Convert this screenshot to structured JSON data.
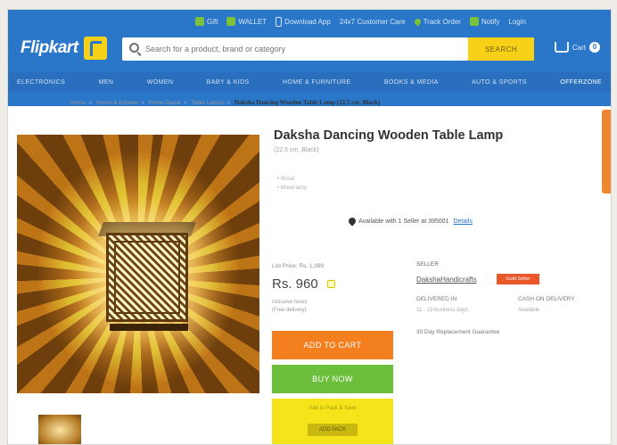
{
  "header": {
    "top_links": [
      {
        "icon": "gift-icon",
        "label": "Gift"
      },
      {
        "icon": "wallet-icon",
        "label": "WALLET"
      },
      {
        "icon": "phone-icon",
        "label": "Download App"
      },
      {
        "icon": "none",
        "label": "24x7 Customer Care"
      },
      {
        "icon": "location-pin-icon",
        "label": "Track Order"
      },
      {
        "icon": "bell-icon",
        "label": "Notify"
      },
      {
        "icon": "none",
        "label": "Login"
      }
    ],
    "logo_text": "Flipkart",
    "search_placeholder": "Search for a product, brand or category",
    "search_button": "SEARCH",
    "cart_label": "Cart",
    "cart_count": "0"
  },
  "nav": {
    "categories": [
      "ELECTRONICS",
      "MEN",
      "WOMEN",
      "BABY & KIDS",
      "HOME & FURNITURE",
      "BOOKS & MEDIA",
      "AUTO & SPORTS",
      "OFFERZONE"
    ]
  },
  "breadcrumb": {
    "items": [
      "Home",
      "Home & Kitchen",
      "Home Decor",
      "Table Lamps"
    ],
    "current": "Daksha Dancing Wooden Table Lamp (22.5 cm, Black)"
  },
  "product": {
    "title": "Daksha Dancing Wooden Table Lamp",
    "subtitle": "(22.5 cm, Black)",
    "bullets": [
      "Wood",
      "Mood lamp"
    ],
    "availability": "Available with 1 Seller at 395001",
    "availability_link": "Details",
    "list_price": "List Price: Rs. 1,099",
    "price": "Rs. 960",
    "price_note_1": "Inclusive taxes",
    "price_note_2": "(Free delivery)",
    "add_to_cart": "ADD TO CART",
    "buy_now": "BUY NOW",
    "pack_label": "Add to Pack & Save",
    "pack_button": "ADD PACK"
  },
  "seller": {
    "label": "SELLER",
    "name": "DakshaHandicrafts",
    "badge": "Gold Seller",
    "delivery_label": "DELIVERED IN",
    "delivery_value": "11 - 13 business days",
    "cash_label": "CASH ON DELIVERY",
    "cash_value": "Available",
    "shipping": "30 Day Replacement Guarantee"
  }
}
